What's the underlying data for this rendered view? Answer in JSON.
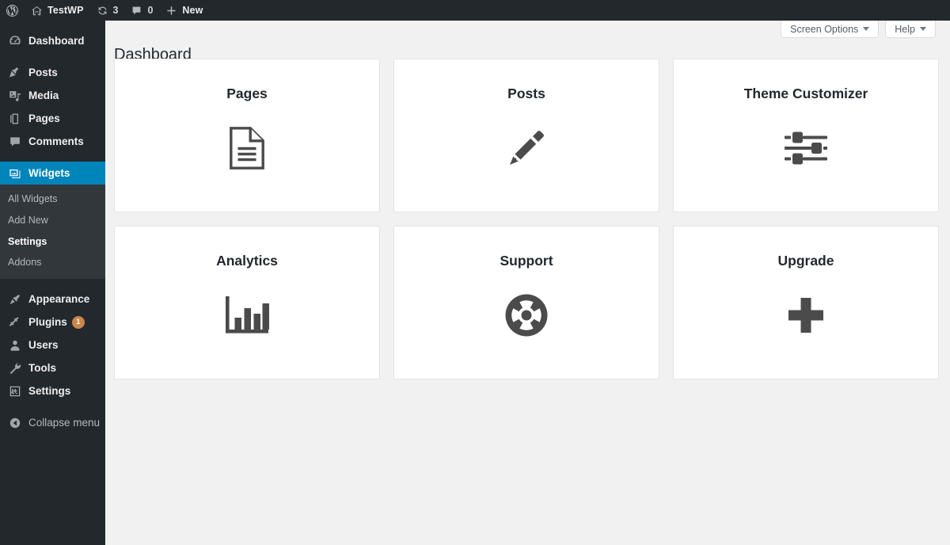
{
  "adminbar": {
    "logo_icon": "wordpress-logo-icon",
    "site": {
      "icon": "home-icon",
      "label": "TestWP"
    },
    "updates": {
      "icon": "updates-icon",
      "count": "3"
    },
    "comments": {
      "icon": "comment-bubble-icon",
      "count": "0"
    },
    "new": {
      "icon": "plus-icon",
      "label": "New"
    }
  },
  "sidebar": {
    "items": [
      {
        "label": "Dashboard",
        "icon": "dashboard-icon",
        "name": "dashboard",
        "current": false,
        "badge": null
      },
      {
        "label": "Posts",
        "icon": "pin-icon",
        "name": "posts",
        "current": false,
        "badge": null
      },
      {
        "label": "Media",
        "icon": "media-icon",
        "name": "media",
        "current": false,
        "badge": null
      },
      {
        "label": "Pages",
        "icon": "pages-icon",
        "name": "pages",
        "current": false,
        "badge": null
      },
      {
        "label": "Comments",
        "icon": "comment-bubble-icon",
        "name": "comments",
        "current": false,
        "badge": null
      },
      {
        "label": "Widgets",
        "icon": "widgets-icon",
        "name": "widgets",
        "current": true,
        "badge": null
      },
      {
        "label": "Appearance",
        "icon": "brush-icon",
        "name": "appearance",
        "current": false,
        "badge": null
      },
      {
        "label": "Plugins",
        "icon": "plugin-icon",
        "name": "plugins",
        "current": false,
        "badge": "1"
      },
      {
        "label": "Users",
        "icon": "user-icon",
        "name": "users",
        "current": false,
        "badge": null
      },
      {
        "label": "Tools",
        "icon": "wrench-icon",
        "name": "tools",
        "current": false,
        "badge": null
      },
      {
        "label": "Settings",
        "icon": "settings-sliders-icon",
        "name": "settings",
        "current": false,
        "badge": null
      },
      {
        "label": "Collapse menu",
        "icon": "collapse-arrow-icon",
        "name": "collapse-menu",
        "current": false,
        "badge": null
      }
    ],
    "submenu": [
      {
        "label": "All Widgets",
        "current": false
      },
      {
        "label": "Add New",
        "current": false
      },
      {
        "label": "Settings",
        "current": true
      },
      {
        "label": "Addons",
        "current": false
      }
    ]
  },
  "screen_meta": {
    "screen_options_label": "Screen Options",
    "help_label": "Help"
  },
  "page": {
    "title": "Dashboard"
  },
  "cards": [
    {
      "title": "Pages",
      "icon": "document-icon"
    },
    {
      "title": "Posts",
      "icon": "pencil-icon"
    },
    {
      "title": "Theme Customizer",
      "icon": "sliders-icon"
    },
    {
      "title": "Analytics",
      "icon": "bar-chart-icon"
    },
    {
      "title": "Support",
      "icon": "lifebuoy-icon"
    },
    {
      "title": "Upgrade",
      "icon": "plus-icon"
    }
  ],
  "colors": {
    "admin_bar_bg": "#23282d",
    "sidebar_bg": "#23282d",
    "submenu_bg": "#32373c",
    "current_highlight": "#0085ba",
    "content_bg": "#f1f1f1",
    "card_bg": "#ffffff",
    "card_border": "#e5e5e5",
    "badge_bg": "#ca8648",
    "icon_gray": "#4b4b4b",
    "text_dark": "#23282d",
    "text_muted": "#b4b9be"
  }
}
